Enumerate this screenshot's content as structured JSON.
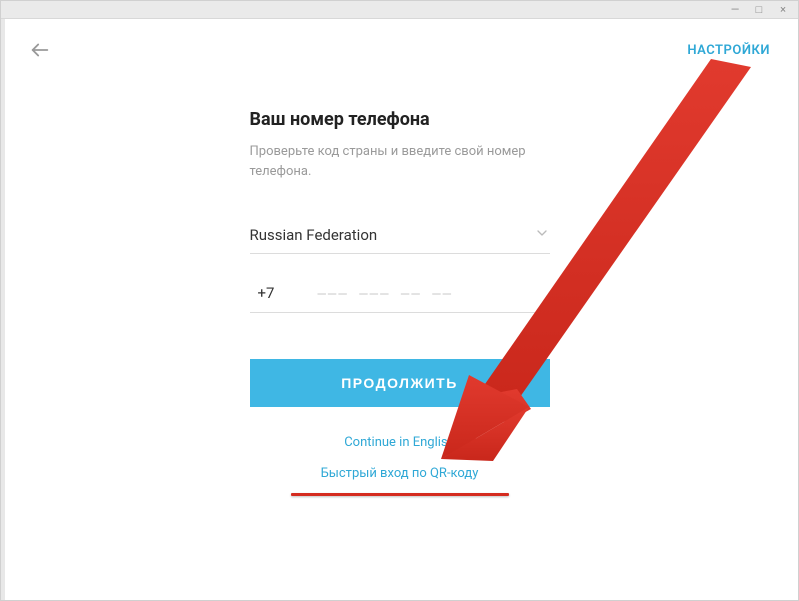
{
  "window": {
    "minimize": "—",
    "maximize": "□",
    "close": "×"
  },
  "header": {
    "settings_label": "НАСТРОЙКИ"
  },
  "login": {
    "title": "Ваш номер телефона",
    "subtitle": "Проверьте код страны и введите свой номер телефона.",
    "country": "Russian Federation",
    "dial_code": "+7",
    "phone_placeholder": "––– ––– –– ––",
    "continue_label": "ПРОДОЛЖИТЬ",
    "english_link": "Continue in English",
    "qr_link": "Быстрый вход по QR-коду"
  }
}
